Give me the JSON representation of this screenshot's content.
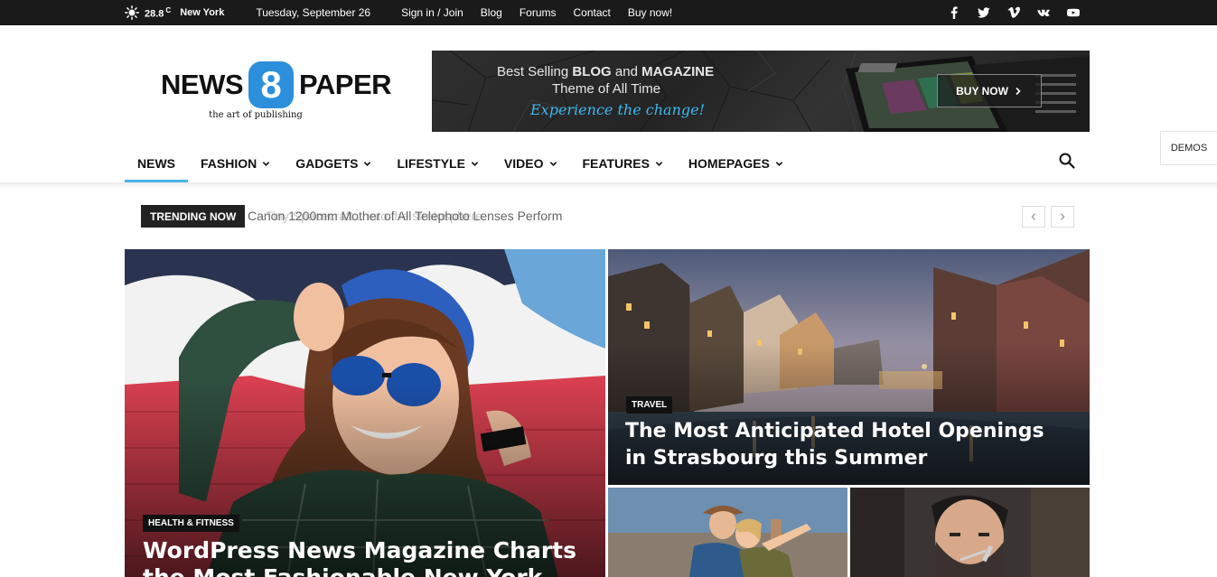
{
  "topbar": {
    "temperature": "28.8",
    "temp_unit": "C",
    "city": "New York",
    "date": "Tuesday, September 26",
    "links": [
      "Sign in / Join",
      "Blog",
      "Forums",
      "Contact",
      "Buy now!"
    ],
    "social_icons": [
      "facebook-icon",
      "twitter-icon",
      "vimeo-icon",
      "vk-icon",
      "youtube-icon"
    ]
  },
  "logo": {
    "left_word": "NEWS",
    "badge": "8",
    "right_word": "PAPER",
    "tagline": "the art of publishing"
  },
  "banner": {
    "line1_prefix": "Best Selling ",
    "line1_blog": "BLOG",
    "line1_and": " and ",
    "line1_magazine": "MAGAZINE",
    "line2": "Theme of All Time",
    "line3": "Experience the change!",
    "button": "BUY NOW"
  },
  "demos_label": "DEMOS",
  "nav": {
    "items": [
      {
        "label": "NEWS",
        "dropdown": false,
        "active": true
      },
      {
        "label": "FASHION",
        "dropdown": true
      },
      {
        "label": "GADGETS",
        "dropdown": true
      },
      {
        "label": "LIFESTYLE",
        "dropdown": true
      },
      {
        "label": "VIDEO",
        "dropdown": true
      },
      {
        "label": "FEATURES",
        "dropdown": true
      },
      {
        "label": "HOMEPAGES",
        "dropdown": true
      }
    ]
  },
  "trending": {
    "label": "TRENDING NOW",
    "headline": "Canon 1200mm Mother of All Telephoto Lenses Perform",
    "ghost_headline": "Tiny Spacecraft... into the stratosphere"
  },
  "tiles": {
    "main": {
      "category": "HEALTH & FITNESS",
      "title_line1": "WordPress News Magazine Charts",
      "title_line2": "the Most Fashionable New York"
    },
    "top_right": {
      "category": "TRAVEL",
      "title_line1": "The Most Anticipated Hotel Openings",
      "title_line2": "in Strasbourg this Summer"
    }
  },
  "colors": {
    "accent": "#4db2ec",
    "topbar_bg": "#1a1a1a",
    "badge_blue": "#2b8fdc"
  }
}
